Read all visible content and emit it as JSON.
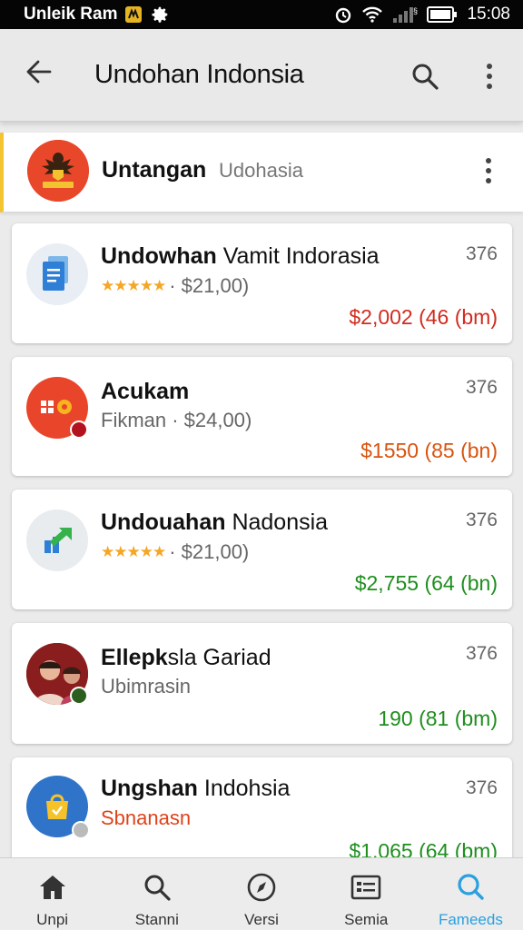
{
  "status_bar": {
    "carrier": "Unleik Ram",
    "time": "15:08"
  },
  "app_bar": {
    "title": "Undohan Indonsia"
  },
  "header": {
    "title": "Untangan",
    "subtitle": "Udohasia"
  },
  "cards": [
    {
      "title_bold": "Undowhan",
      "title_rest": " Vamit Indorasia",
      "stars": "★★★★★",
      "subtitle": "· $21,00)",
      "count": "376",
      "price": "$2,002 (46 (bm)",
      "price_color": "#d12b1f"
    },
    {
      "title_bold": "Acukam",
      "title_rest": "",
      "stars": "",
      "subtitle": "Fikman · $24,00)",
      "count": "376",
      "price": "$1550 (85 (bn)",
      "price_color": "#d9530f"
    },
    {
      "title_bold": "Undouahan",
      "title_rest": " Nadonsia",
      "stars": "★★★★★",
      "subtitle": "· $21,00)",
      "count": "376",
      "price": "$2,755 (64 (bn)",
      "price_color": "#1e8e1e"
    },
    {
      "title_bold": "Ellepk",
      "title_rest": "sla Gariad",
      "stars": "",
      "subtitle": "Ubimrasin",
      "count": "376",
      "price": "190 (81 (bm)",
      "price_color": "#1e8e1e"
    },
    {
      "title_bold": "Ungshan",
      "title_rest": " Indohsia",
      "stars": "",
      "subtitle": "Sbnanasn",
      "subtitle_color": "#e0421a",
      "count": "376",
      "price": "$1,065 (64 (bm)",
      "price_color": "#1e8e1e"
    }
  ],
  "bottom_nav": [
    {
      "label": "Unpi",
      "icon": "home-icon"
    },
    {
      "label": "Stanni",
      "icon": "search-icon"
    },
    {
      "label": "Versi",
      "icon": "compass-icon"
    },
    {
      "label": "Semia",
      "icon": "list-card-icon"
    },
    {
      "label": "Fameeds",
      "icon": "search-icon",
      "active": true
    }
  ],
  "colors": {
    "accent": "#2aa0e0",
    "header_border": "#f4c430",
    "status_bar": "#050505"
  }
}
